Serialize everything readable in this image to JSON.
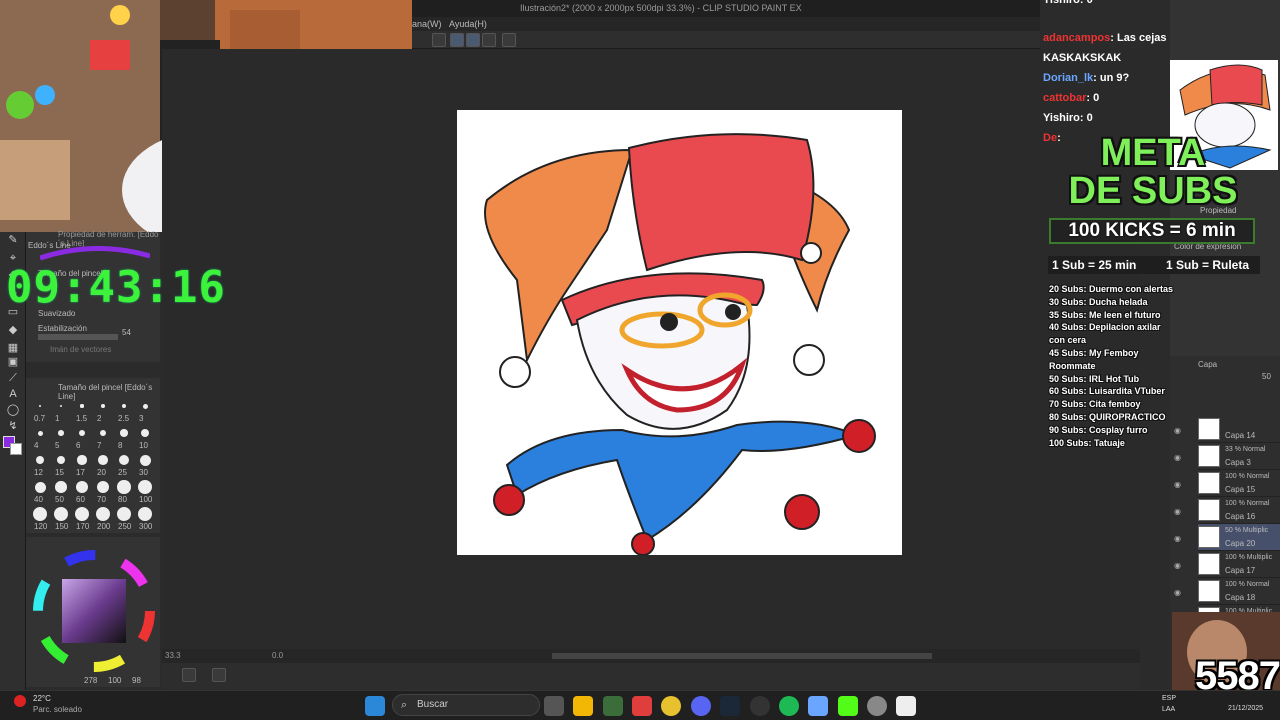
{
  "window": {
    "title": "Ilustración2* (2000 x 2000px 500dpi 33.3%) - CLIP STUDIO PAINT EX"
  },
  "menu": {
    "items": [
      "ana(W)",
      "Ayuda(H)"
    ]
  },
  "subtool": {
    "title": "Propiedad de herram. [Eddo´s Line]",
    "brush_name": "Eddo´s Line",
    "size_label": "Tamaño del pincel",
    "smoothing_label": "Suavizado",
    "stabilization_label": "Estabilización",
    "stabilization_value": "54",
    "vector_label": "Imán de vectores"
  },
  "brushsize": {
    "title": "Tamaño del pincel [Eddo´s Line]",
    "sizes": [
      "0.7",
      "1",
      "1.5",
      "2",
      "2.5",
      "3",
      "4",
      "5",
      "6",
      "7",
      "8",
      "10",
      "12",
      "15",
      "17",
      "20",
      "25",
      "30",
      "40",
      "50",
      "60",
      "70",
      "80",
      "100",
      "120",
      "150",
      "170",
      "200",
      "250",
      "300"
    ]
  },
  "clock": {
    "time": "09:43:16"
  },
  "color": {
    "readout": "278",
    "v2": "100",
    "v3": "98",
    "accent": "#8a2be2"
  },
  "status": {
    "zoom": "33.3",
    "coords": "0.0"
  },
  "chat": {
    "lines": [
      {
        "user": "Yishiro",
        "text": ": 0"
      },
      {
        "user": "adancampos",
        "text": ": Las cejas"
      },
      {
        "user": "",
        "text": "KASKAKSKAK"
      },
      {
        "user": "Dorian_lk",
        "text": ": un 9?"
      },
      {
        "user": "cattobar",
        "text": ": 0"
      },
      {
        "user": "Yishiro",
        "text": ": 0"
      },
      {
        "user": "De",
        "text": ":"
      }
    ]
  },
  "overlay": {
    "meta_line1": "META",
    "meta_line2": "DE SUBS",
    "kicks": "100 KICKS = 6 min",
    "sub1": "1 Sub = 25 min",
    "sub2": "1 Sub = Ruleta",
    "goals": [
      "20 Subs: Duermo con alertas",
      "30 Subs: Ducha helada",
      "35 Subs: Me leen el futuro",
      "40 Subs: Depilacion axilar con cera",
      "45 Subs: My Femboy Roommate",
      "50 Subs: IRL Hot Tub",
      "60 Subs: Luisardita VTuber",
      "70 Subs: Cita femboy",
      "80 Subs: QUIROPRACTICO",
      "90 Subs: Cosplay furro",
      "100 Subs: Tatuaje"
    ],
    "counter": "5587"
  },
  "rightpanel": {
    "property": "Propiedad",
    "color_expr": "Color de expresión",
    "layer_tab": "Capa",
    "opacity": "50"
  },
  "layers": [
    {
      "mode": "",
      "name": "Capa 14"
    },
    {
      "mode": "33 % Normal",
      "name": "Capa 3"
    },
    {
      "mode": "100 % Normal",
      "name": "Capa 15"
    },
    {
      "mode": "100 % Normal",
      "name": "Capa 16"
    },
    {
      "mode": "50 % Multiplic",
      "name": "Capa 20"
    },
    {
      "mode": "100 % Multiplic",
      "name": "Capa 17"
    },
    {
      "mode": "100 % Normal",
      "name": "Capa 18"
    },
    {
      "mode": "100 % Multiplic",
      "name": ""
    }
  ],
  "taskbar": {
    "weather_temp": "22°C",
    "weather_desc": "Parc. soleado",
    "search_placeholder": "Buscar",
    "lang": "ESP",
    "lang2": "LAA",
    "date": "21/12/2025"
  }
}
